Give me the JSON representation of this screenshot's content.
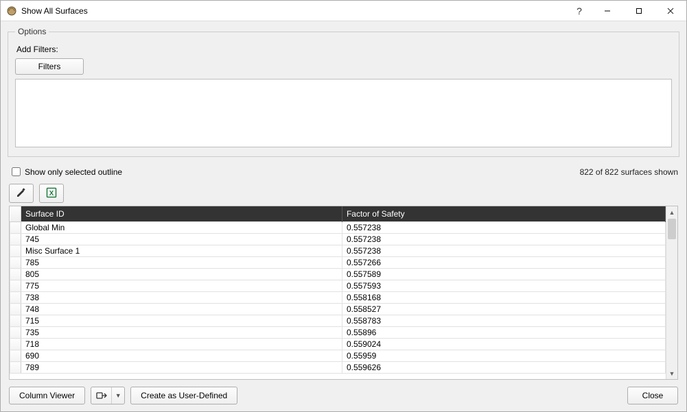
{
  "window": {
    "title": "Show All Surfaces"
  },
  "options": {
    "legend": "Options",
    "add_filters_label": "Add Filters:",
    "filters_button": "Filters",
    "filters_text": ""
  },
  "middle": {
    "checkbox_label": "Show only selected outline",
    "checkbox_checked": false,
    "status": "822 of 822 surfaces shown"
  },
  "columns": {
    "surface_id": "Surface ID",
    "factor_of_safety": "Factor of Safety"
  },
  "rows": [
    {
      "surface_id": "Global Min",
      "fos": "0.557238"
    },
    {
      "surface_id": "745",
      "fos": "0.557238"
    },
    {
      "surface_id": "Misc Surface 1",
      "fos": "0.557238"
    },
    {
      "surface_id": "785",
      "fos": "0.557266"
    },
    {
      "surface_id": "805",
      "fos": "0.557589"
    },
    {
      "surface_id": "775",
      "fos": "0.557593"
    },
    {
      "surface_id": "738",
      "fos": "0.558168"
    },
    {
      "surface_id": "748",
      "fos": "0.558527"
    },
    {
      "surface_id": "715",
      "fos": "0.558783"
    },
    {
      "surface_id": "735",
      "fos": "0.55896"
    },
    {
      "surface_id": "718",
      "fos": "0.559024"
    },
    {
      "surface_id": "690",
      "fos": "0.55959"
    },
    {
      "surface_id": "789",
      "fos": "0.559626"
    }
  ],
  "footer": {
    "column_viewer": "Column Viewer",
    "create_user_defined": "Create as User-Defined",
    "close": "Close"
  }
}
